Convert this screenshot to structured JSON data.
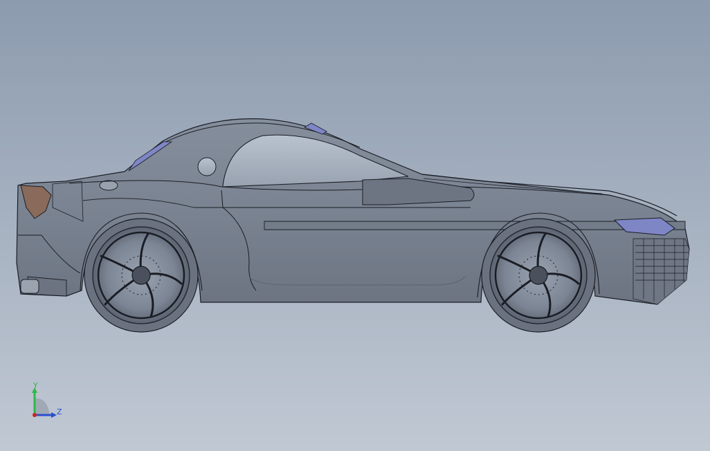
{
  "viewport": {
    "view": "side",
    "render_mode": "shaded-with-edges",
    "colors": {
      "background_top": "#8c9bae",
      "background_bottom": "#c0c8d3",
      "body": "#7b8493",
      "edge": "#1a1d24",
      "glass": "#aab4c2",
      "tail_light": "#8a6a5a",
      "blue_trim": "#7f86c6"
    }
  },
  "triad": {
    "y_label": "Y",
    "z_label": "Z",
    "y_color": "#2fb84a",
    "z_color": "#2a4fd0",
    "x_color": "#d02020"
  }
}
